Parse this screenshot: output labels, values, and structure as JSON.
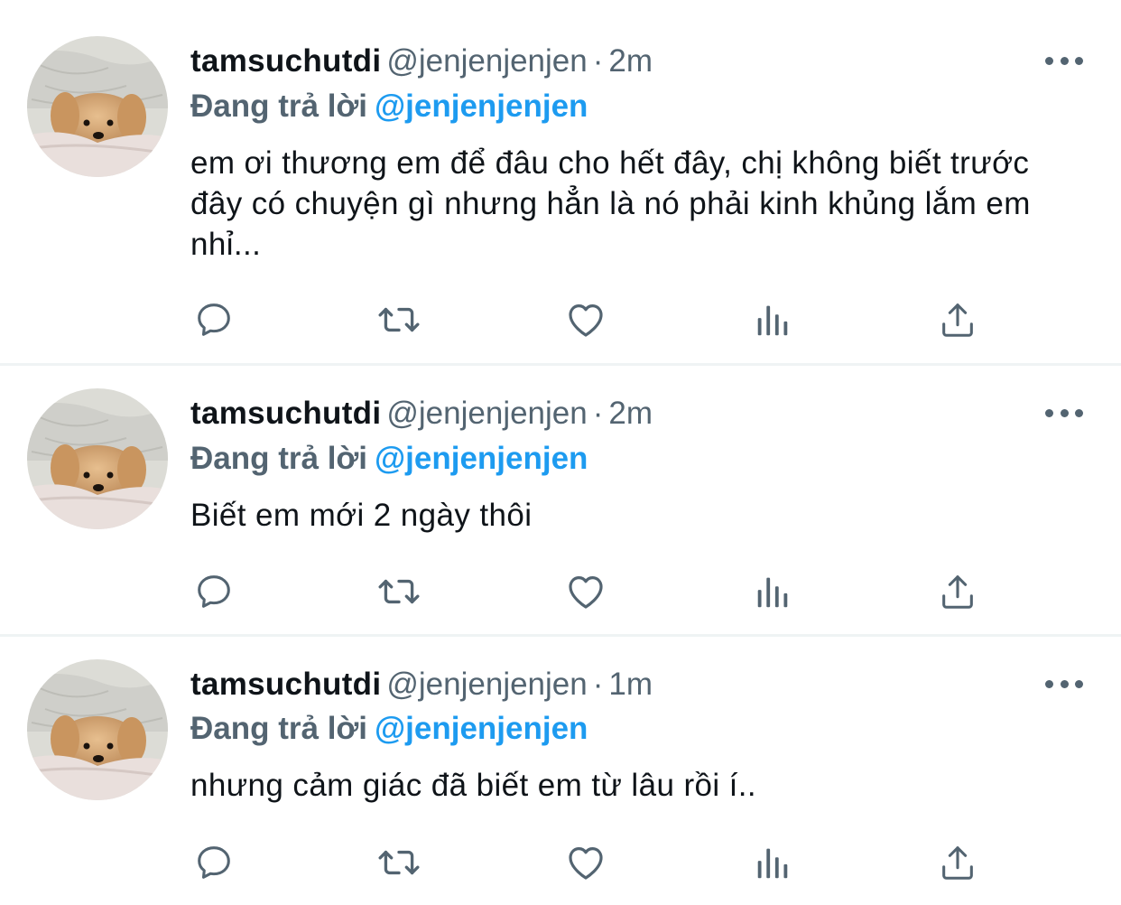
{
  "tweets": [
    {
      "name": "tamsuchutdi",
      "handle": "@jenjenjenjen",
      "dot": "·",
      "time": "2m",
      "reply_prefix": "Đang trả lời",
      "reply_to": "@jenjenjenjen",
      "text": "em ơi thương em để đâu cho hết đây, chị không biết trước đây có chuyện gì nhưng hẳn là nó phải kinh khủng lắm em nhỉ..."
    },
    {
      "name": "tamsuchutdi",
      "handle": "@jenjenjenjen",
      "dot": "·",
      "time": "2m",
      "reply_prefix": "Đang trả lời",
      "reply_to": "@jenjenjenjen",
      "text": "Biết em mới 2 ngày thôi"
    },
    {
      "name": "tamsuchutdi",
      "handle": "@jenjenjenjen",
      "dot": "·",
      "time": "1m",
      "reply_prefix": "Đang trả lời",
      "reply_to": "@jenjenjenjen",
      "text": "nhưng cảm giác đã biết em từ lâu rồi í.."
    }
  ],
  "icons": {
    "reply": "reply-icon",
    "retweet": "retweet-icon",
    "like": "heart-icon",
    "analytics": "analytics-icon",
    "share": "share-icon",
    "more": "more-icon"
  },
  "colors": {
    "text": "#0f1419",
    "secondary": "#536471",
    "accent": "#1d9bf0",
    "divider": "#eff3f4"
  }
}
